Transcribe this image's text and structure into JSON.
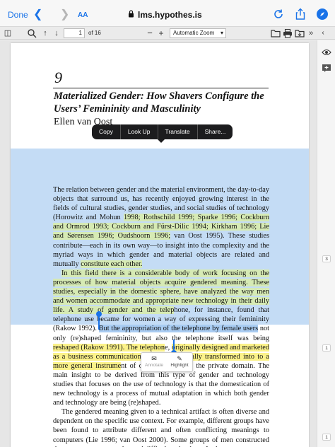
{
  "safari": {
    "done_label": "Done",
    "text_size_label": "AA",
    "url": "lms.hypothes.is"
  },
  "pdf_toolbar": {
    "page_number": "1",
    "page_total": "of 16",
    "zoom_label": "Automatic Zoom"
  },
  "document": {
    "chapter_number": "9",
    "chapter_title": "Materialized Gender: How Shavers Configure the Users’ Femininity and Masculinity",
    "author": "Ellen van Oost",
    "p1_a": "The relation between gender and the material environment, the day-to-day objects that surround us, has recently enjoyed growing interest in the fields of cultural studies, gender studies, and social studies of technology (Horowitz and Mohun ",
    "p1_hl": "1998; Rothschild 1999; Sparke 1996; Cockburn and Ormrod 1993; Cockburn and Fürst-Dilic 1994; Kirkham 1996; Lie and Sørensen 1996; Oudshoorn 1996;",
    "p1_b": " van Oost 1995). These studies contribute—each in its own way—to insight into the complexity and the myriad ways in which gender and material objects are related and mutually ",
    "p1_hl2": "constitute each other.",
    "p2_hl": "In this field there is a considerable body of work focusing on the processes of how material objects acquire gendered meaning. These studies, especially in the domestic sphere, have analyzed the way men and women accommodate and appropriate new technology in their daily life. A study of gender and the telep",
    "p2_a": "hone, for instance, found that telephone use became for women a way of expressing their femininity (Rakow 1992). ",
    "p2_sel": "But the appropriation of the telephone by female users",
    "p2_b": " not only (re)shaped femininity, but also the telephone itself was being ",
    "p2_hly1": "reshaped (Rakow 1991). The telephon",
    "p2_c": "e, ",
    "p2_hly2": "originally designed and marketed as a business communication tool, was gradually transformed into to a more general instrume",
    "p2_d": "nt of communication in the private domain. The main insight to be derived from this type of gender and technology studies that focuses on the use of technology is that the domestication of new technology is a process of mutual adaptation in which both gender and technology are being (re)shaped.",
    "p3": "The gendered meaning given to a technical artifact is often diverse and dependent on the specific use context. For example, different groups have been found to attribute different and often conflicting meanings to computers (Lie 1996; van Oost 2000). Some groups of men constructed the computer as a complex and difficult technology. In these"
  },
  "context_menu": {
    "items": [
      "Copy",
      "Look Up",
      "Translate",
      "Share..."
    ]
  },
  "hypothesis_popup": {
    "annotate_label": "Annotate",
    "highlight_label": "Highlight"
  },
  "sidebar": {
    "counts": [
      "3",
      "1",
      "1"
    ]
  }
}
